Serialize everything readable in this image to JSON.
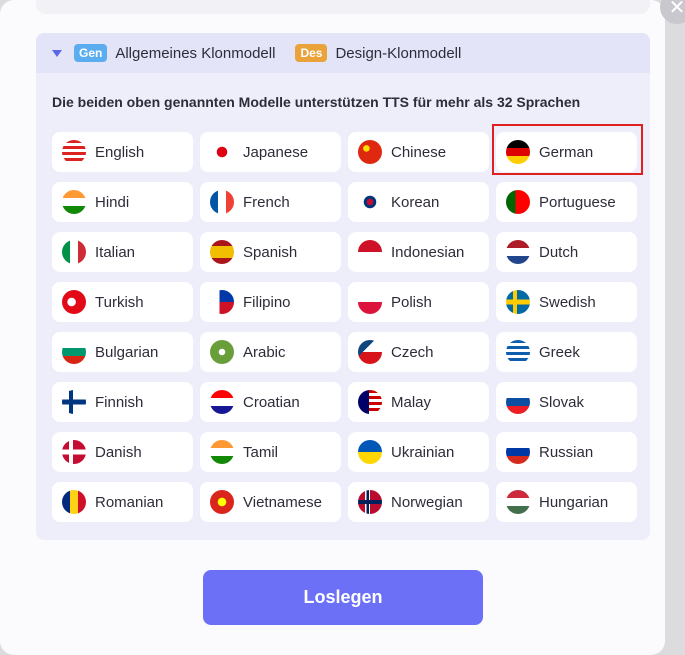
{
  "header": {
    "gen_badge": "Gen",
    "gen_model": "Allgemeines Klonmodell",
    "des_badge": "Des",
    "des_model": "Design-Klonmodell"
  },
  "description": "Die beiden oben genannten Modelle unterstützen TTS für mehr als 32 Sprachen",
  "languages": [
    {
      "label": "English",
      "icon": "us-flag-icon"
    },
    {
      "label": "Japanese",
      "icon": "japan-flag-icon"
    },
    {
      "label": "Chinese",
      "icon": "china-flag-icon"
    },
    {
      "label": "German",
      "icon": "germany-flag-icon",
      "selected": true
    },
    {
      "label": "Hindi",
      "icon": "india-flag-icon"
    },
    {
      "label": "French",
      "icon": "france-flag-icon"
    },
    {
      "label": "Korean",
      "icon": "korea-flag-icon"
    },
    {
      "label": "Portuguese",
      "icon": "portugal-flag-icon"
    },
    {
      "label": "Italian",
      "icon": "italy-flag-icon"
    },
    {
      "label": "Spanish",
      "icon": "spain-flag-icon"
    },
    {
      "label": "Indonesian",
      "icon": "indonesia-flag-icon"
    },
    {
      "label": "Dutch",
      "icon": "netherlands-flag-icon"
    },
    {
      "label": "Turkish",
      "icon": "turkey-flag-icon"
    },
    {
      "label": "Filipino",
      "icon": "philippines-flag-icon"
    },
    {
      "label": "Polish",
      "icon": "poland-flag-icon"
    },
    {
      "label": "Swedish",
      "icon": "sweden-flag-icon"
    },
    {
      "label": "Bulgarian",
      "icon": "bulgaria-flag-icon"
    },
    {
      "label": "Arabic",
      "icon": "saudi-flag-icon"
    },
    {
      "label": "Czech",
      "icon": "czech-flag-icon"
    },
    {
      "label": "Greek",
      "icon": "greece-flag-icon"
    },
    {
      "label": "Finnish",
      "icon": "finland-flag-icon"
    },
    {
      "label": "Croatian",
      "icon": "croatia-flag-icon"
    },
    {
      "label": "Malay",
      "icon": "malaysia-flag-icon"
    },
    {
      "label": "Slovak",
      "icon": "slovakia-flag-icon"
    },
    {
      "label": "Danish",
      "icon": "denmark-flag-icon"
    },
    {
      "label": "Tamil",
      "icon": "india-flag-icon"
    },
    {
      "label": "Ukrainian",
      "icon": "ukraine-flag-icon"
    },
    {
      "label": "Russian",
      "icon": "russia-flag-icon"
    },
    {
      "label": "Romanian",
      "icon": "romania-flag-icon"
    },
    {
      "label": "Vietnamese",
      "icon": "vietnam-flag-icon"
    },
    {
      "label": "Norwegian",
      "icon": "norway-flag-icon"
    },
    {
      "label": "Hungarian",
      "icon": "hungary-flag-icon"
    }
  ],
  "start_button": "Loslegen",
  "colors": {
    "accent": "#6c70f6",
    "selected_border": "#e02020"
  }
}
